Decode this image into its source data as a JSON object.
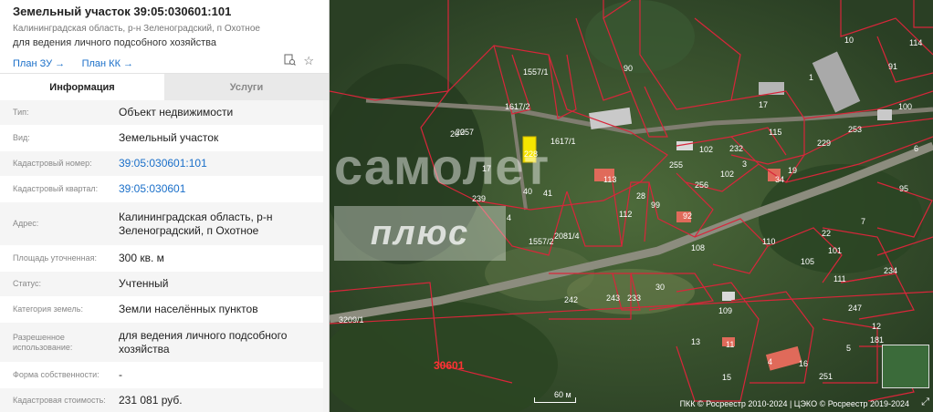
{
  "header": {
    "title": "Земельный участок 39:05:030601:101",
    "address": "Калининградская область, р-н Зеленоградский, п Охотное",
    "purpose": "для ведения личного подсобного хозяйства",
    "plan_zu": "План ЗУ →",
    "plan_kk": "План КК →"
  },
  "tabs": {
    "info": "Информация",
    "services": "Услуги"
  },
  "rows": [
    {
      "label": "Тип:",
      "value": "Объект недвижимости"
    },
    {
      "label": "Вид:",
      "value": "Земельный участок"
    },
    {
      "label": "Кадастровый номер:",
      "value": "39:05:030601:101"
    },
    {
      "label": "Кадастровый квартал:",
      "value": "39:05:030601"
    },
    {
      "label": "Адрес:",
      "value": "Калининградская область, р-н Зеленоградский, п Охотное"
    },
    {
      "label": "Площадь уточненная:",
      "value": "300 кв. м"
    },
    {
      "label": "Статус:",
      "value": "Учтенный"
    },
    {
      "label": "Категория земель:",
      "value": "Земли населённых пунктов"
    },
    {
      "label": "Разрешенное использование:",
      "value": "для ведения личного подсобного хозяйства"
    },
    {
      "label": "Форма собственности:",
      "value": "-"
    },
    {
      "label": "Кадастровая стоимость:",
      "value": "231 081 руб."
    }
  ],
  "map": {
    "watermark_top": "самолет",
    "watermark_bottom": "плюс",
    "scale": "60 м",
    "copyright": "ПКК © Росреестр 2010-2024 | ЦЭКО © Росреестр 2019-2024",
    "quarter_label": "30601",
    "side_label": "3209/1",
    "parcels": [
      "10",
      "114",
      "91",
      "90",
      "1",
      "100",
      "17",
      "115",
      "229",
      "253",
      "6",
      "102",
      "232",
      "255",
      "256",
      "102",
      "3",
      "19",
      "34",
      "95",
      "17",
      "40",
      "41",
      "113",
      "28",
      "99",
      "92",
      "239",
      "108",
      "112",
      "22",
      "7",
      "110",
      "111",
      "105",
      "234",
      "242",
      "243",
      "233",
      "30",
      "109",
      "247",
      "12",
      "11",
      "13",
      "15",
      "16",
      "251",
      "5",
      "181",
      "101",
      "228",
      "257",
      "1617/1",
      "1617/2",
      "1557/1",
      "1557/2",
      "2081/4",
      "20",
      "4"
    ]
  }
}
